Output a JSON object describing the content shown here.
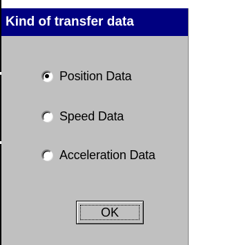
{
  "dialog": {
    "title": "Kind of transfer data"
  },
  "options": [
    {
      "label": "Position Data",
      "selected": true
    },
    {
      "label": "Speed Data",
      "selected": false
    },
    {
      "label": "Acceleration Data",
      "selected": false
    }
  ],
  "buttons": {
    "ok_label": "OK"
  },
  "colors": {
    "title_bar": "#000080",
    "panel": "#c0c0c0",
    "background": "#ffffff"
  }
}
